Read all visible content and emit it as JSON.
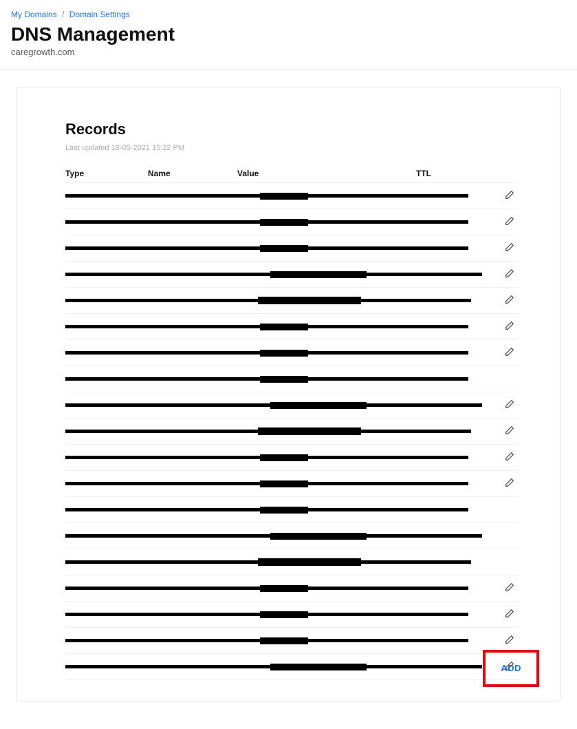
{
  "breadcrumb": {
    "item1": "My Domains",
    "item2": "Domain Settings"
  },
  "header": {
    "title": "DNS Management",
    "domain": "caregrowth.com"
  },
  "records": {
    "section_title": "Records",
    "last_updated": "Last updated 18-05-2021 15:22 PM",
    "columns": {
      "type": "Type",
      "name": "Name",
      "value": "Value",
      "ttl": "TTL"
    },
    "rows": [
      {
        "editable": true
      },
      {
        "editable": true
      },
      {
        "editable": true
      },
      {
        "editable": true
      },
      {
        "editable": true
      },
      {
        "editable": true
      },
      {
        "editable": true
      },
      {
        "editable": false
      },
      {
        "editable": true
      },
      {
        "editable": true
      },
      {
        "editable": true
      },
      {
        "editable": true
      },
      {
        "editable": false
      },
      {
        "editable": false
      },
      {
        "editable": false
      },
      {
        "editable": true
      },
      {
        "editable": true
      },
      {
        "editable": true
      },
      {
        "editable": true
      }
    ],
    "add_label": "ADD"
  }
}
